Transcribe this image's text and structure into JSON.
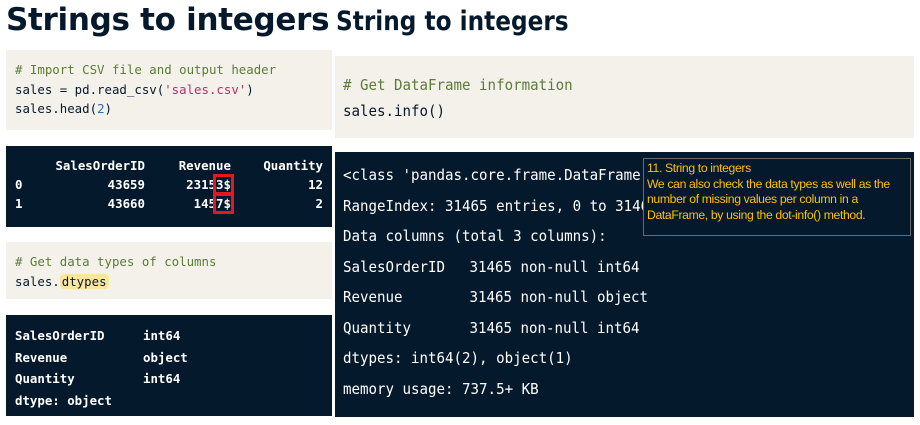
{
  "left": {
    "title": "Strings to integers",
    "code1": {
      "comment": "# Import CSV file and output header",
      "line2_a": "sales = pd.read_csv(",
      "line2_str": "'sales.csv'",
      "line2_b": ")",
      "line3_a": "sales.head(",
      "line3_num": "2",
      "line3_b": ")"
    },
    "head_table": {
      "columns": [
        "",
        "SalesOrderID",
        "Revenue",
        "Quantity"
      ],
      "rows": [
        {
          "index": "0",
          "SalesOrderID": "43659",
          "Revenue_num": "2315",
          "Revenue_tail": "3$",
          "Quantity": "12"
        },
        {
          "index": "1",
          "SalesOrderID": "43660",
          "Revenue_num": "145",
          "Revenue_tail": "7$",
          "Quantity": "2"
        }
      ]
    },
    "code2": {
      "comment": "# Get data types of columns",
      "prefix": "sales.",
      "highlight": "dtypes"
    },
    "dtypes_output": {
      "rows": [
        {
          "name": "SalesOrderID",
          "type": "int64"
        },
        {
          "name": "Revenue",
          "type": "object"
        },
        {
          "name": "Quantity",
          "type": "int64"
        }
      ],
      "footer": "dtype: object"
    }
  },
  "right": {
    "title": "String to integers",
    "code": {
      "comment": "# Get DataFrame information",
      "call": "sales.info()"
    },
    "info_output": {
      "class_line": "<class 'pandas.core.frame.DataFrame'>",
      "range_line": "RangeIndex: 31465 entries, 0 to 31464",
      "columns_line": "Data columns (total 3 columns):",
      "rows": [
        {
          "name": "SalesOrderID",
          "info": "31465 non-null int64"
        },
        {
          "name": "Revenue",
          "info": "31465 non-null object"
        },
        {
          "name": "Quantity",
          "info": "31465 non-null int64"
        }
      ],
      "dtypes_line": "dtypes: int64(2), object(1)",
      "memory_line": "memory usage: 737.5+ KB"
    }
  },
  "note": {
    "title": "11. String to integers",
    "body": "We can also check the data types as well as the number of missing values per column in a DataFrame, by using the dot-info() method."
  },
  "colors": {
    "navy": "#05192d",
    "cream": "#f4f1ea",
    "highlight_box": "#e01b1b",
    "note_text": "#ffc000"
  }
}
